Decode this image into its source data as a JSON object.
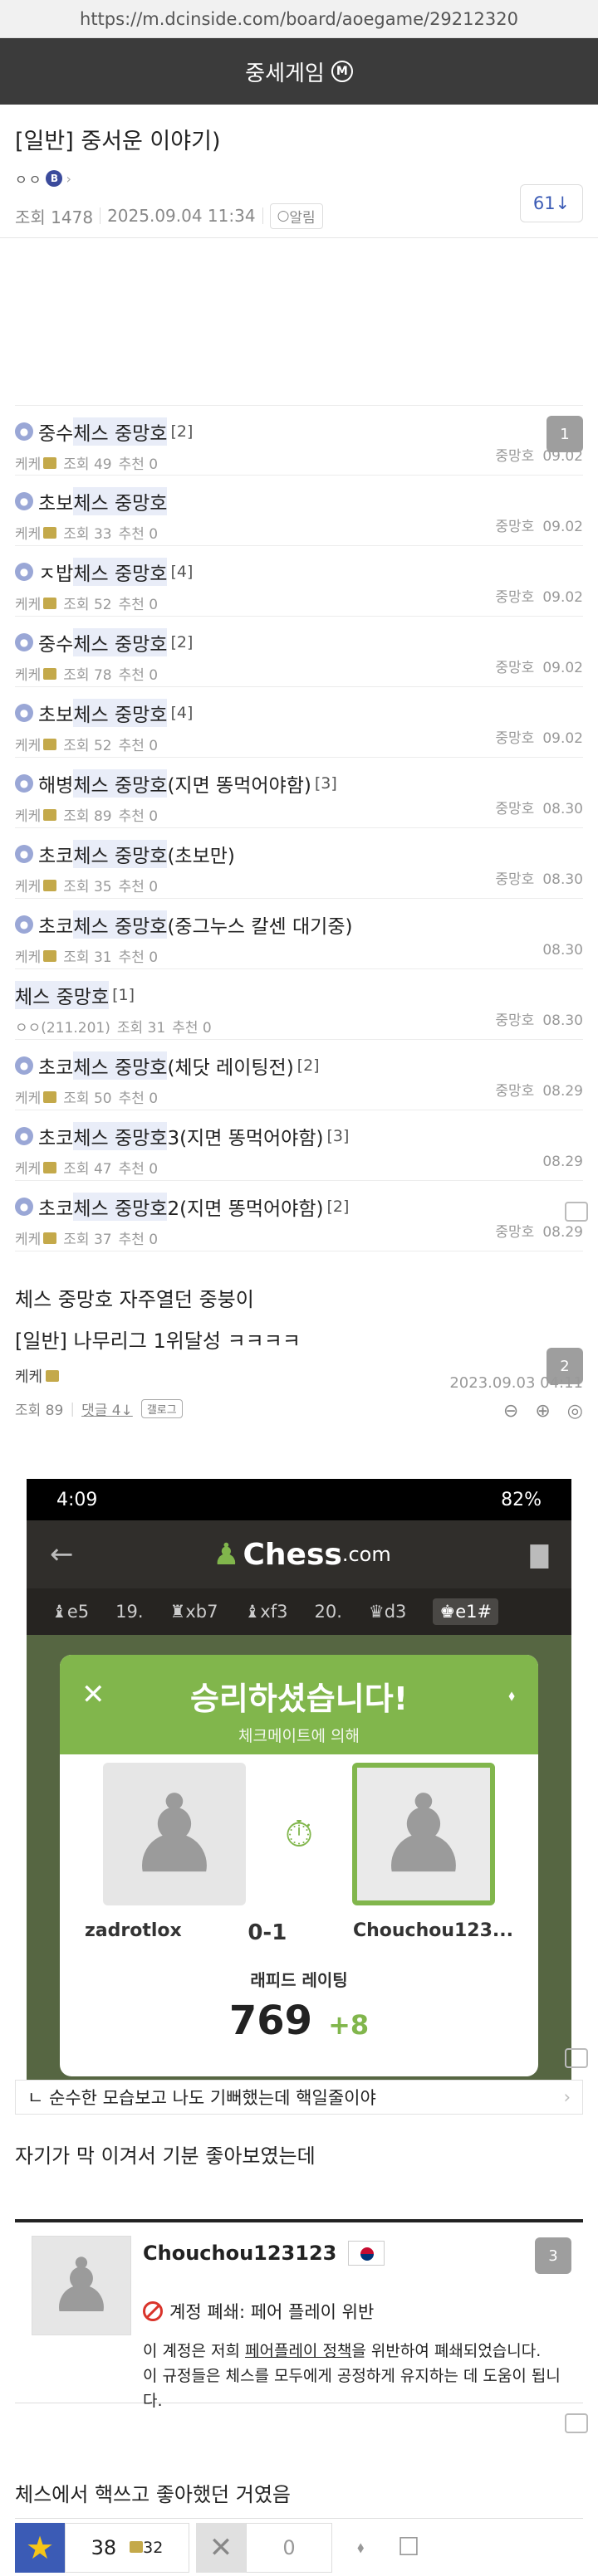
{
  "url": "https://m.dcinside.com/board/aoegame/29212320",
  "gallery": {
    "name": "중세게임",
    "minor_mark": "M"
  },
  "post": {
    "title": "[일반] 중서운 이야기)",
    "author_ip": "ㅇㅇ",
    "author_badge": "B",
    "views": "조회 1478",
    "date": "2025.09.04 11:34",
    "alarm": "알림",
    "comment_count": "61↓"
  },
  "related": [
    {
      "pre": "중수",
      "hl": "체스 중망호",
      "post": "",
      "reply": "[2]",
      "author": "케케",
      "views": "조회 49",
      "rec": "추천 0",
      "right_name": "중망호",
      "date": "09.02",
      "badge": "1"
    },
    {
      "pre": "초보",
      "hl": "체스 중망호",
      "post": "",
      "reply": "",
      "author": "케케",
      "views": "조회 33",
      "rec": "추천 0",
      "right_name": "중망호",
      "date": "09.02",
      "badge": ""
    },
    {
      "pre": "ㅈ밥",
      "hl": "체스 중망호",
      "post": "",
      "reply": "[4]",
      "author": "케케",
      "views": "조회 52",
      "rec": "추천 0",
      "right_name": "중망호",
      "date": "09.02",
      "badge": ""
    },
    {
      "pre": "중수",
      "hl": "체스 중망호",
      "post": "",
      "reply": "[2]",
      "author": "케케",
      "views": "조회 78",
      "rec": "추천 0",
      "right_name": "중망호",
      "date": "09.02",
      "badge": ""
    },
    {
      "pre": "초보",
      "hl": "체스 중망호",
      "post": "",
      "reply": "[4]",
      "author": "케케",
      "views": "조회 52",
      "rec": "추천 0",
      "right_name": "중망호",
      "date": "09.02",
      "badge": ""
    },
    {
      "pre": "해병",
      "hl": "체스 중망호",
      "post": "(지면 똥먹어야함)",
      "reply": "[3]",
      "author": "케케",
      "views": "조회 89",
      "rec": "추천 0",
      "right_name": "중망호",
      "date": "08.30",
      "badge": ""
    },
    {
      "pre": "초코",
      "hl": "체스 중망호",
      "post": "(초보만)",
      "reply": "",
      "author": "케케",
      "views": "조회 35",
      "rec": "추천 0",
      "right_name": "중망호",
      "date": "08.30",
      "badge": ""
    },
    {
      "pre": "초코",
      "hl": "체스 중망호",
      "post": "(중그누스 칼센 대기중)",
      "reply": "",
      "author": "케케",
      "views": "조회 31",
      "rec": "추천 0",
      "right_name": "",
      "date": "08.30",
      "badge": ""
    },
    {
      "pre": "",
      "hl": "체스 중망호",
      "post": "",
      "reply": "[1]",
      "author": "ㅇㅇ(211.201)",
      "views": "조회 31",
      "rec": "추천 0",
      "right_name": "중망호",
      "date": "08.30",
      "badge": "",
      "no_icon": true
    },
    {
      "pre": "초코",
      "hl": "체스 중망호",
      "post": "(체닷 레이팅전)",
      "reply": "[2]",
      "author": "케케",
      "views": "조회 50",
      "rec": "추천 0",
      "right_name": "중망호",
      "date": "08.29",
      "badge": ""
    },
    {
      "pre": "초코",
      "hl": "체스 중망호",
      "post": " 3(지면 똥먹어야함)",
      "reply": "[3]",
      "author": "케케",
      "views": "조회 47",
      "rec": "추천 0",
      "right_name": "",
      "date": "08.29",
      "badge": ""
    },
    {
      "pre": "초코",
      "hl": "체스 중망호",
      "post": " 2(지면 똥먹어야함)",
      "reply": "[2]",
      "author": "케케",
      "views": "조회 37",
      "rec": "추천 0",
      "right_name": "중망호",
      "date": "08.29",
      "badge": ""
    }
  ],
  "body_lines": {
    "line1": "체스 중망호 자주열던 중붕이",
    "line2": "자기가 막 이겨서 기분 좋아보였는데",
    "line3": "체스에서 핵쓰고 좋아했던 거였음"
  },
  "embed": {
    "title": "[일반] 나무리그 1위달성 ㅋㅋㅋㅋ",
    "author": "케케",
    "views": "조회 89",
    "comments": "댓글 4↓",
    "gallery_tag": "갤로그",
    "date": "2023.09.03 04:11",
    "badge": "2",
    "caption": "ㄴ 순수한 모습보고 나도 기뻐했는데 핵일줄이야"
  },
  "phone": {
    "time": "4:09",
    "battery": "82%",
    "logo_main": "Chess",
    "logo_suffix": ".com",
    "moves": [
      "e5",
      "19.",
      "xb7",
      "xf3",
      "20.",
      "d3",
      "e1#"
    ],
    "win_text": "승리하셨습니다!",
    "win_sub": "체크메이트에 의해",
    "player1": "zadrotlox",
    "score": "0-1",
    "player2": "Chouchou123...",
    "rating_label": "래피드 레이팅",
    "rating": "769",
    "rating_delta": "+8"
  },
  "account": {
    "name": "Chouchou123123",
    "status": "계정 폐쇄: 페어 플레이 위반",
    "text_before": "이 계정은 저희 ",
    "text_link": "페어플레이 정책",
    "text_after": "을 위반하여 폐쇄되었습니다.",
    "text2": "이 규정들은 체스를 모두에게 공정하게 유지하는 데 도움이 됩니다.",
    "badge": "3"
  },
  "bottom": {
    "likes": "38",
    "gallery_likes": "32",
    "dislikes": "0"
  },
  "colors": {
    "accent": "#3b5bb5",
    "chess_green": "#81b64c",
    "header": "#3b3b3b"
  }
}
